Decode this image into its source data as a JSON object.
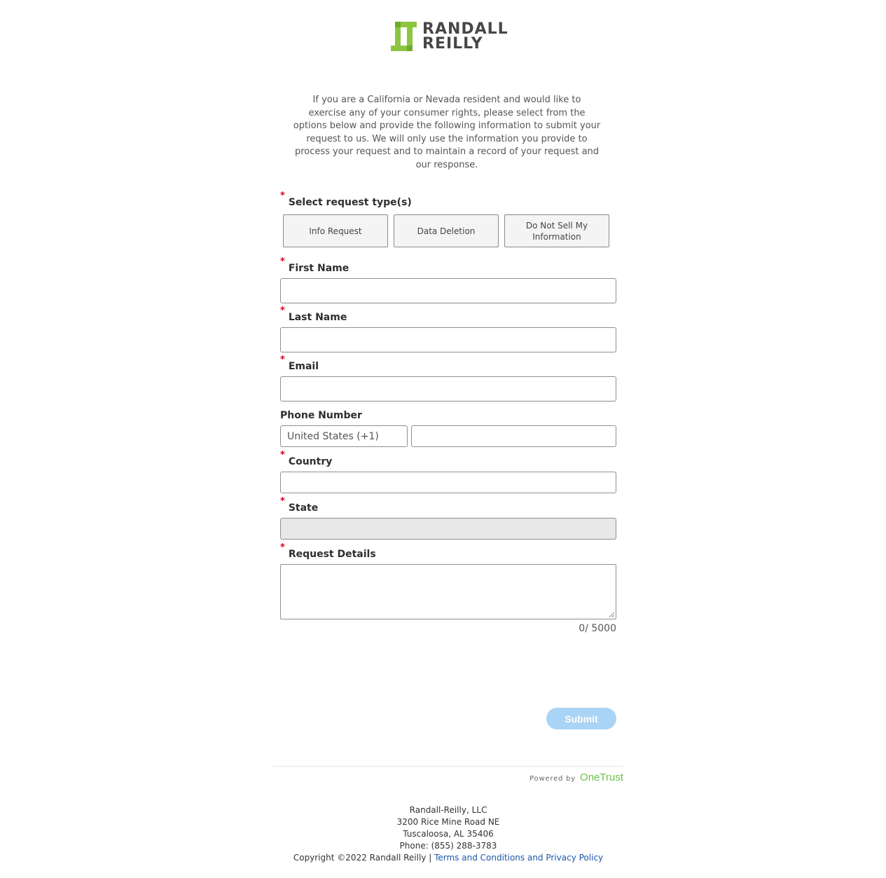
{
  "brand": {
    "logo_line1": "RANDALL",
    "logo_line2": "REILLY",
    "colors": {
      "logo_green": "#8cc63f",
      "logo_text": "#474747",
      "required": "#d0021b",
      "submit_bg": "#a9d4f5",
      "link": "#1a56a8",
      "onetrust": "#6cc04a"
    }
  },
  "intro_text": "If you are a California or Nevada resident and would like to exercise any of your consumer rights, please select from the options below and provide the following information to submit your request to us. We will only use the information you provide to process your request and to maintain a record of your request and our response.",
  "form": {
    "request_type_label": "Select request type(s)",
    "request_types": [
      "Info Request",
      "Data Deletion",
      "Do Not Sell My Information"
    ],
    "required_marker": "*",
    "first_name_label": "First Name",
    "first_name_value": "",
    "last_name_label": "Last Name",
    "last_name_value": "",
    "email_label": "Email",
    "email_value": "",
    "phone_label": "Phone Number",
    "phone_country": "United States (+1)",
    "phone_value": "",
    "country_label": "Country",
    "country_value": "",
    "state_label": "State",
    "state_value": "",
    "details_label": "Request Details",
    "details_value": "",
    "counter": "0/ 5000",
    "submit_label": "Submit"
  },
  "powered": {
    "by": "Powered by",
    "name": "OneTrust"
  },
  "footer": {
    "company": "Randall-Reilly, LLC",
    "address1": "3200 Rice Mine Road NE",
    "address2": "Tuscaloosa, AL 35406",
    "phone": "Phone: (855) 288-3783",
    "copyright": "Copyright ©2022 Randall Reilly | ",
    "link": "Terms and Conditions and Privacy Policy"
  }
}
